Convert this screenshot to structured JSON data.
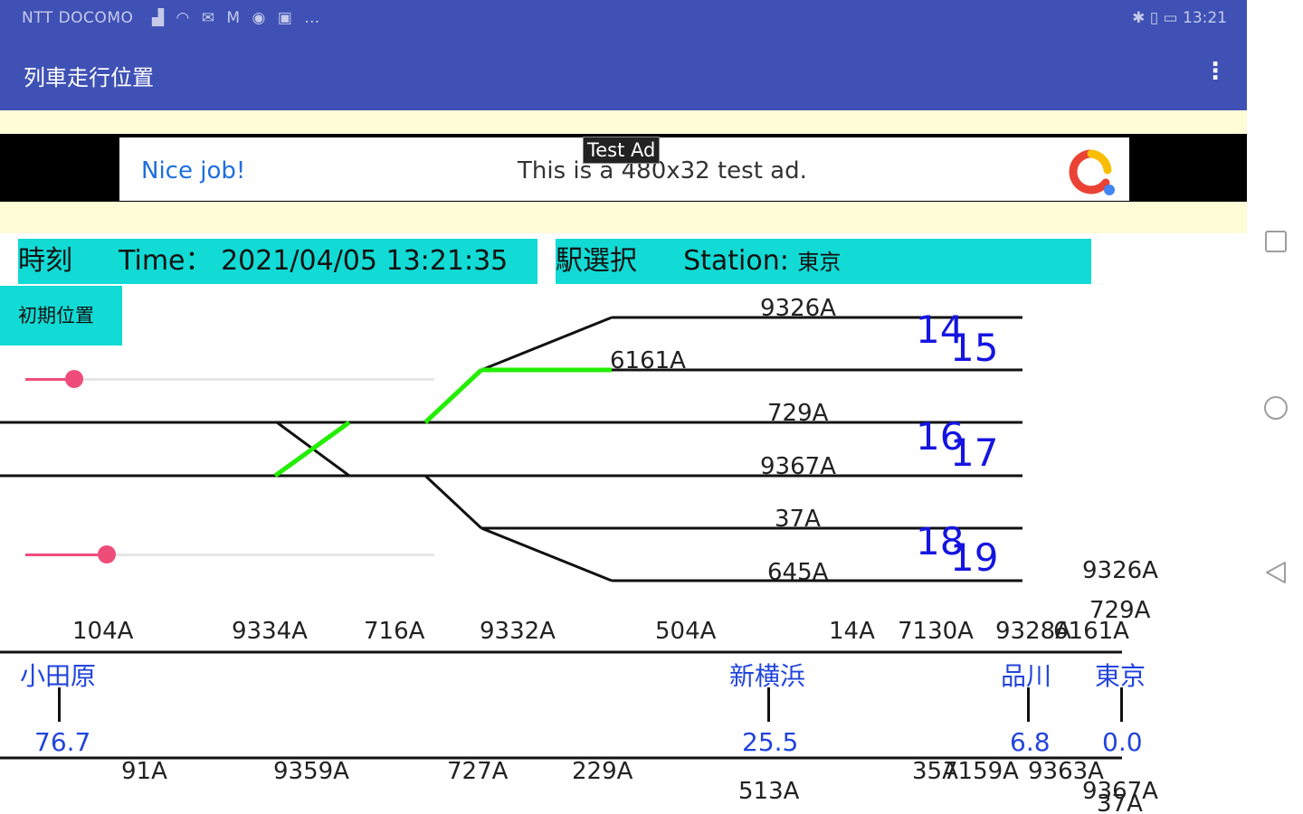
{
  "status_bar": {
    "carrier": "NTT DOCOMO",
    "time": "13:21",
    "icons": [
      "signal-icon",
      "wifi-icon",
      "mail-icon",
      "gmail-icon",
      "sync-icon",
      "notification-icon"
    ],
    "overflow": "…"
  },
  "app_bar": {
    "title": "列車走行位置",
    "menu_icon": "overflow-menu-icon"
  },
  "ad": {
    "tag": "Test Ad",
    "nice": "Nice job!",
    "text": "This is a 480x32 test ad."
  },
  "time_box": {
    "label": "時刻",
    "time_prefix": "Time：",
    "value": "2021/04/05 13:21:35"
  },
  "station_box": {
    "label": "駅選択",
    "station_prefix": "Station:",
    "value": "東京"
  },
  "init_button": "初期位置",
  "sliders": [
    {
      "value_fraction": 0.12
    },
    {
      "value_fraction": 0.2
    }
  ],
  "platform_trains": [
    "9326A",
    "6161A",
    "729A",
    "9367A",
    "37A",
    "645A"
  ],
  "platforms": [
    "14",
    "15",
    "16",
    "17",
    "18",
    "19"
  ],
  "right_labels": [
    "9326A",
    "729A",
    "6161A"
  ],
  "upper_trains": [
    "104A",
    "9334A",
    "716A",
    "9332A",
    "504A",
    "14A",
    "7130A",
    "9328A"
  ],
  "stations": [
    {
      "name": "小田原",
      "km": "76.7"
    },
    {
      "name": "新横浜",
      "km": "25.5"
    },
    {
      "name": "品川",
      "km": "6.8"
    },
    {
      "name": "東京",
      "km": "0.0"
    }
  ],
  "lower_trains": [
    "91A",
    "9359A",
    "727A",
    "229A",
    "513A",
    "35A",
    "7159A",
    "9363A",
    "9367A",
    "37A"
  ],
  "nav": {
    "square": "recent-apps-icon",
    "circle": "home-icon",
    "triangle": "back-icon"
  },
  "colors": {
    "primary": "#3f51b5",
    "cyan": "#12dad4",
    "route": "#22ee00",
    "slider": "#ee4d7a",
    "platform_number": "#1515e0"
  }
}
